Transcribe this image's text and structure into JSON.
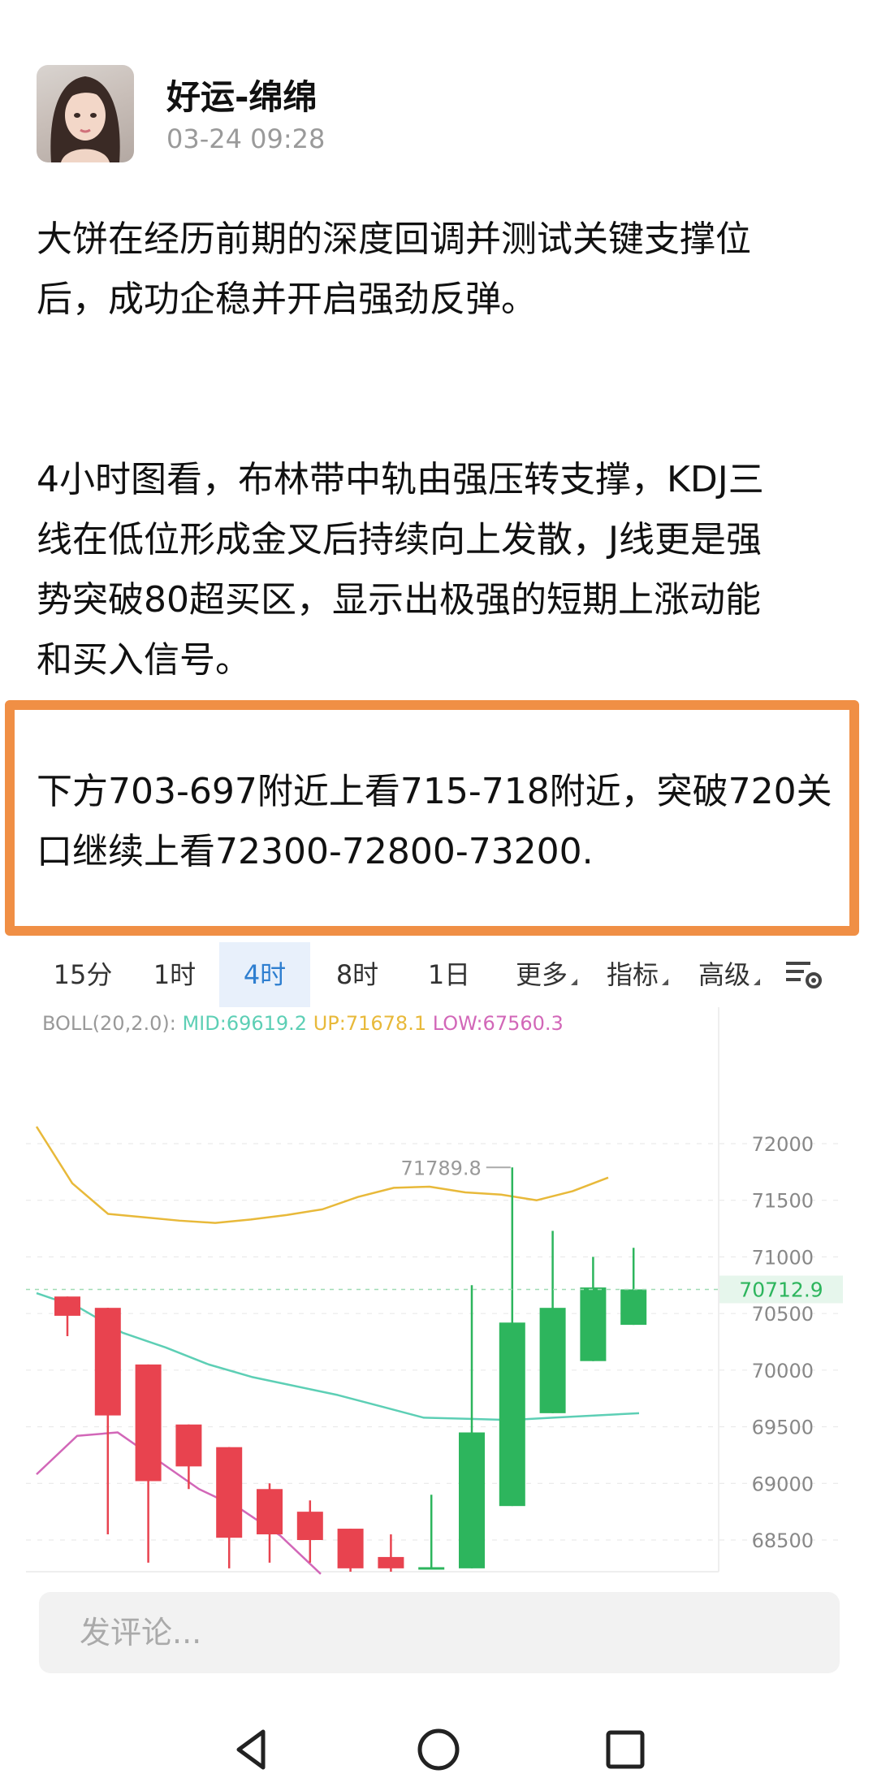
{
  "post": {
    "author": "好运-绵绵",
    "time": "03-24 09:28",
    "para1_line1": "大饼在经历前期的深度回调并测试关键支撑位",
    "para1_line2": "后，成功企稳并开启强劲反弹。",
    "para2_line1": "4小时图看，布林带中轨由强压转支撑，KDJ三",
    "para2_line2": "线在低位形成金叉后持续向上发散，J线更是强",
    "para2_line3": "势突破80超买区，显示出极强的短期上涨动能",
    "para2_line4": "和买入信号。",
    "para3_line1": "下方703-697附近上看715-718附近，突破720关",
    "para3_line2": "口继续上看72300-72800-73200."
  },
  "tabs": [
    "15分",
    "1时",
    "4时",
    "8时",
    "1日",
    "更多",
    "指标",
    "高级"
  ],
  "active_tab": "4时",
  "colors": {
    "up": "#2db55d",
    "down": "#e8434f",
    "mid": "#5dcfb5",
    "upper": "#e8b93a",
    "lower": "#d267b8",
    "accent": "#2f7fd0",
    "highlight_border": "#f08f45"
  },
  "chart_data": {
    "type": "candlestick",
    "indicator": {
      "label": "BOLL(20,2.0):",
      "mid_label": "MID:69619.2",
      "up_label": "UP:71678.1",
      "low_label": "LOW:67560.3"
    },
    "y_ticks": [
      "72000",
      "71500",
      "71000",
      "70500",
      "70000",
      "69500",
      "69000",
      "68500"
    ],
    "ylim": [
      68250,
      72900
    ],
    "current_price": "70712.9",
    "high_label": "71789.8",
    "candles": [
      {
        "o": 70650,
        "h": 70650,
        "l": 70300,
        "c": 70480
      },
      {
        "o": 70550,
        "h": 70550,
        "l": 68550,
        "c": 69600
      },
      {
        "o": 70050,
        "h": 70050,
        "l": 68300,
        "c": 69020
      },
      {
        "o": 69520,
        "h": 69520,
        "l": 68950,
        "c": 69150
      },
      {
        "o": 69320,
        "h": 69320,
        "l": 68250,
        "c": 68520
      },
      {
        "o": 68950,
        "h": 69000,
        "l": 68300,
        "c": 68550
      },
      {
        "o": 68750,
        "h": 68850,
        "l": 68300,
        "c": 68500
      },
      {
        "o": 68600,
        "h": 68600,
        "l": 68200,
        "c": 68250
      },
      {
        "o": 68350,
        "h": 68550,
        "l": 68200,
        "c": 68250
      },
      {
        "o": 68250,
        "h": 68900,
        "l": 68250,
        "c": 68260
      },
      {
        "o": 68250,
        "h": 70750,
        "l": 68250,
        "c": 69450
      },
      {
        "o": 68800,
        "h": 71789.8,
        "l": 68800,
        "c": 70420
      },
      {
        "o": 69620,
        "h": 71230,
        "l": 69620,
        "c": 70550
      },
      {
        "o": 70080,
        "h": 71000,
        "l": 70080,
        "c": 70730
      },
      {
        "o": 70400,
        "h": 71080,
        "l": 70400,
        "c": 70712.9
      }
    ],
    "boll_upper": [
      72150,
      71650,
      71380,
      71350,
      71320,
      71300,
      71330,
      71370,
      71420,
      71530,
      71610,
      71620,
      71570,
      71550,
      71500,
      71580,
      71700
    ],
    "boll_mid": [
      70680,
      70550,
      70330,
      70200,
      70050,
      69940,
      69860,
      69780,
      69680,
      69580,
      69570,
      69560,
      69580,
      69600,
      69620
    ],
    "boll_lower": [
      69080,
      69420,
      69450,
      69200,
      68950,
      68780,
      68540,
      68200
    ]
  },
  "comment": {
    "placeholder": "发评论..."
  }
}
